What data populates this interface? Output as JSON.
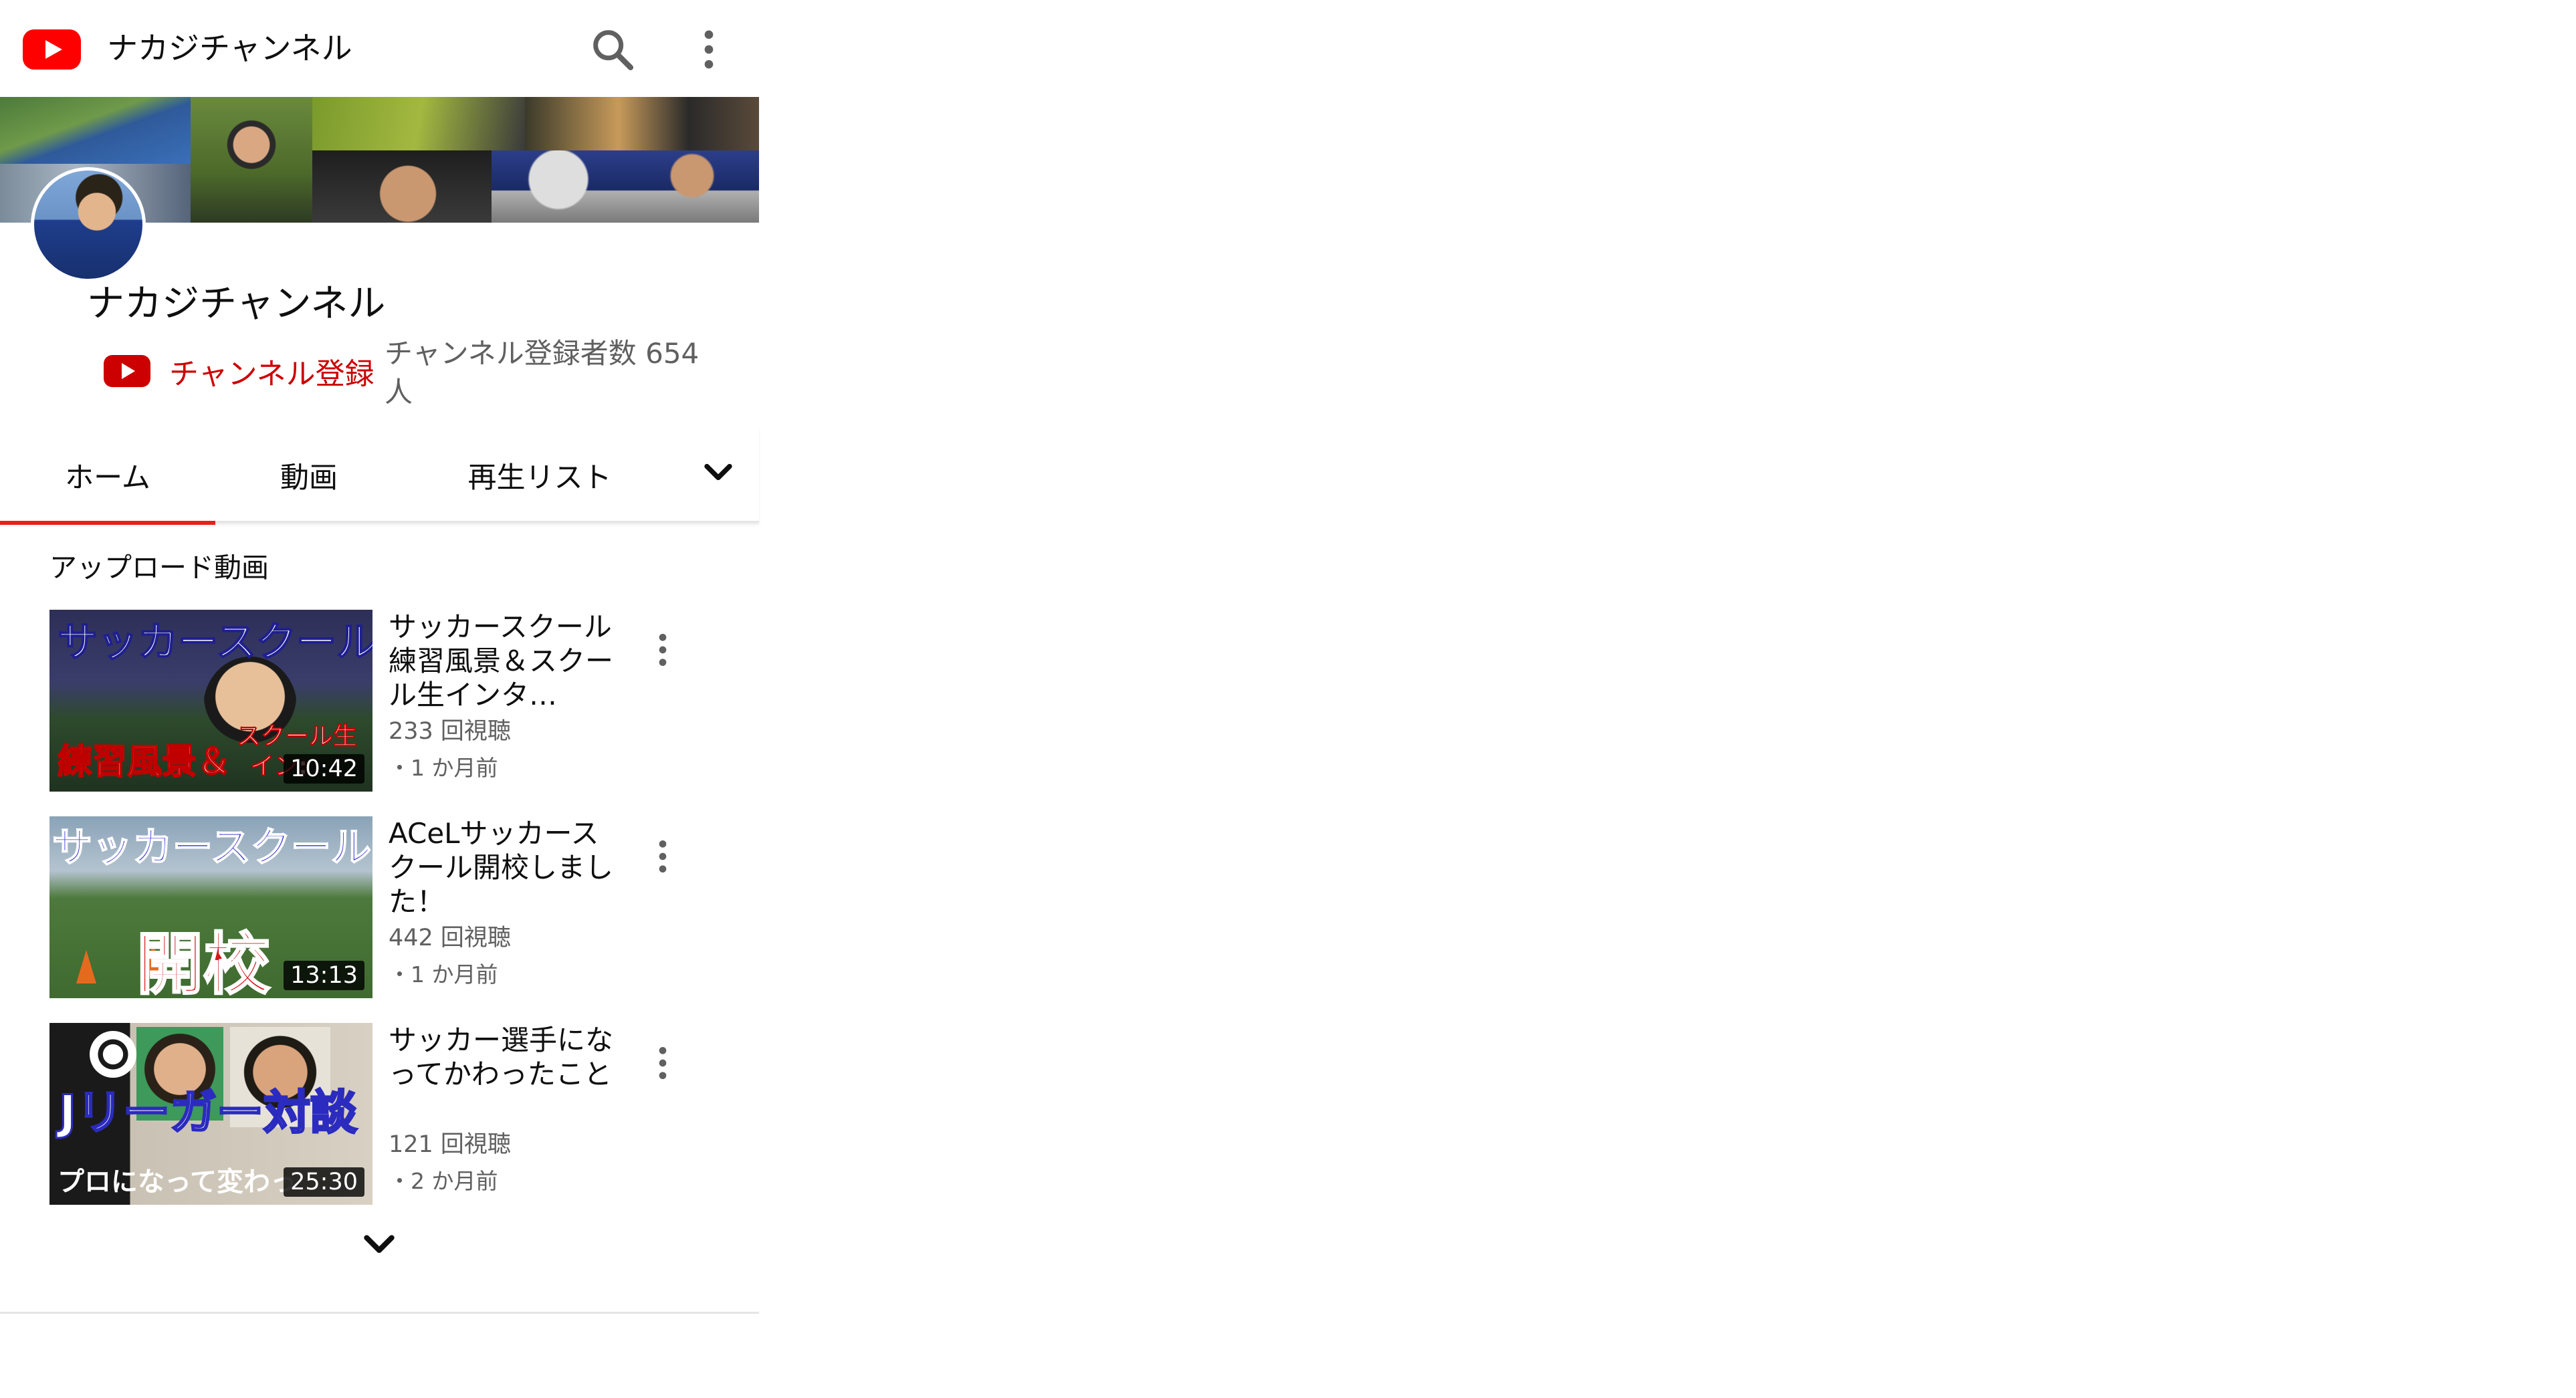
{
  "topbar": {
    "title": "ナカジチャンネル",
    "logo_icon": "youtube-logo-icon",
    "search_icon": "search-icon",
    "menu_icon": "more-vert-icon"
  },
  "channel": {
    "name": "ナカジチャンネル",
    "subscribe_label": "チャンネル登録",
    "subscriber_count": "チャンネル登録者数 654 人"
  },
  "tabs": [
    {
      "label": "ホーム",
      "active": true
    },
    {
      "label": "動画",
      "active": false
    },
    {
      "label": "再生リスト",
      "active": false
    }
  ],
  "section": {
    "title": "アップロード動画"
  },
  "videos": [
    {
      "title": "サッカースクール練習風景＆スクール生インタ…",
      "views": "233 回視聴",
      "age": "・1 か月前",
      "duration": "10:42",
      "thumb_top": "サッカースクール",
      "thumb_bottom": "練習風景＆",
      "thumb_badge": "スクール生",
      "thumb_badge2": "イン:"
    },
    {
      "title": "ACeLサッカースクール開校しました！",
      "views": "442 回視聴",
      "age": "・1 か月前",
      "duration": "13:13",
      "thumb_top": "サッカースクール",
      "thumb_big": "開校"
    },
    {
      "title": "サッカー選手になってかわったこと",
      "views": "121 回視聴",
      "age": "・2 か月前",
      "duration": "25:30",
      "thumb_top": "Jリーガー対談",
      "thumb_bottom": "プロになって変わっ"
    }
  ],
  "colors": {
    "brand_red": "#ff0000",
    "subscribe_red": "#cc0000",
    "tab_indicator": "#e62117",
    "secondary_text": "#606060"
  }
}
